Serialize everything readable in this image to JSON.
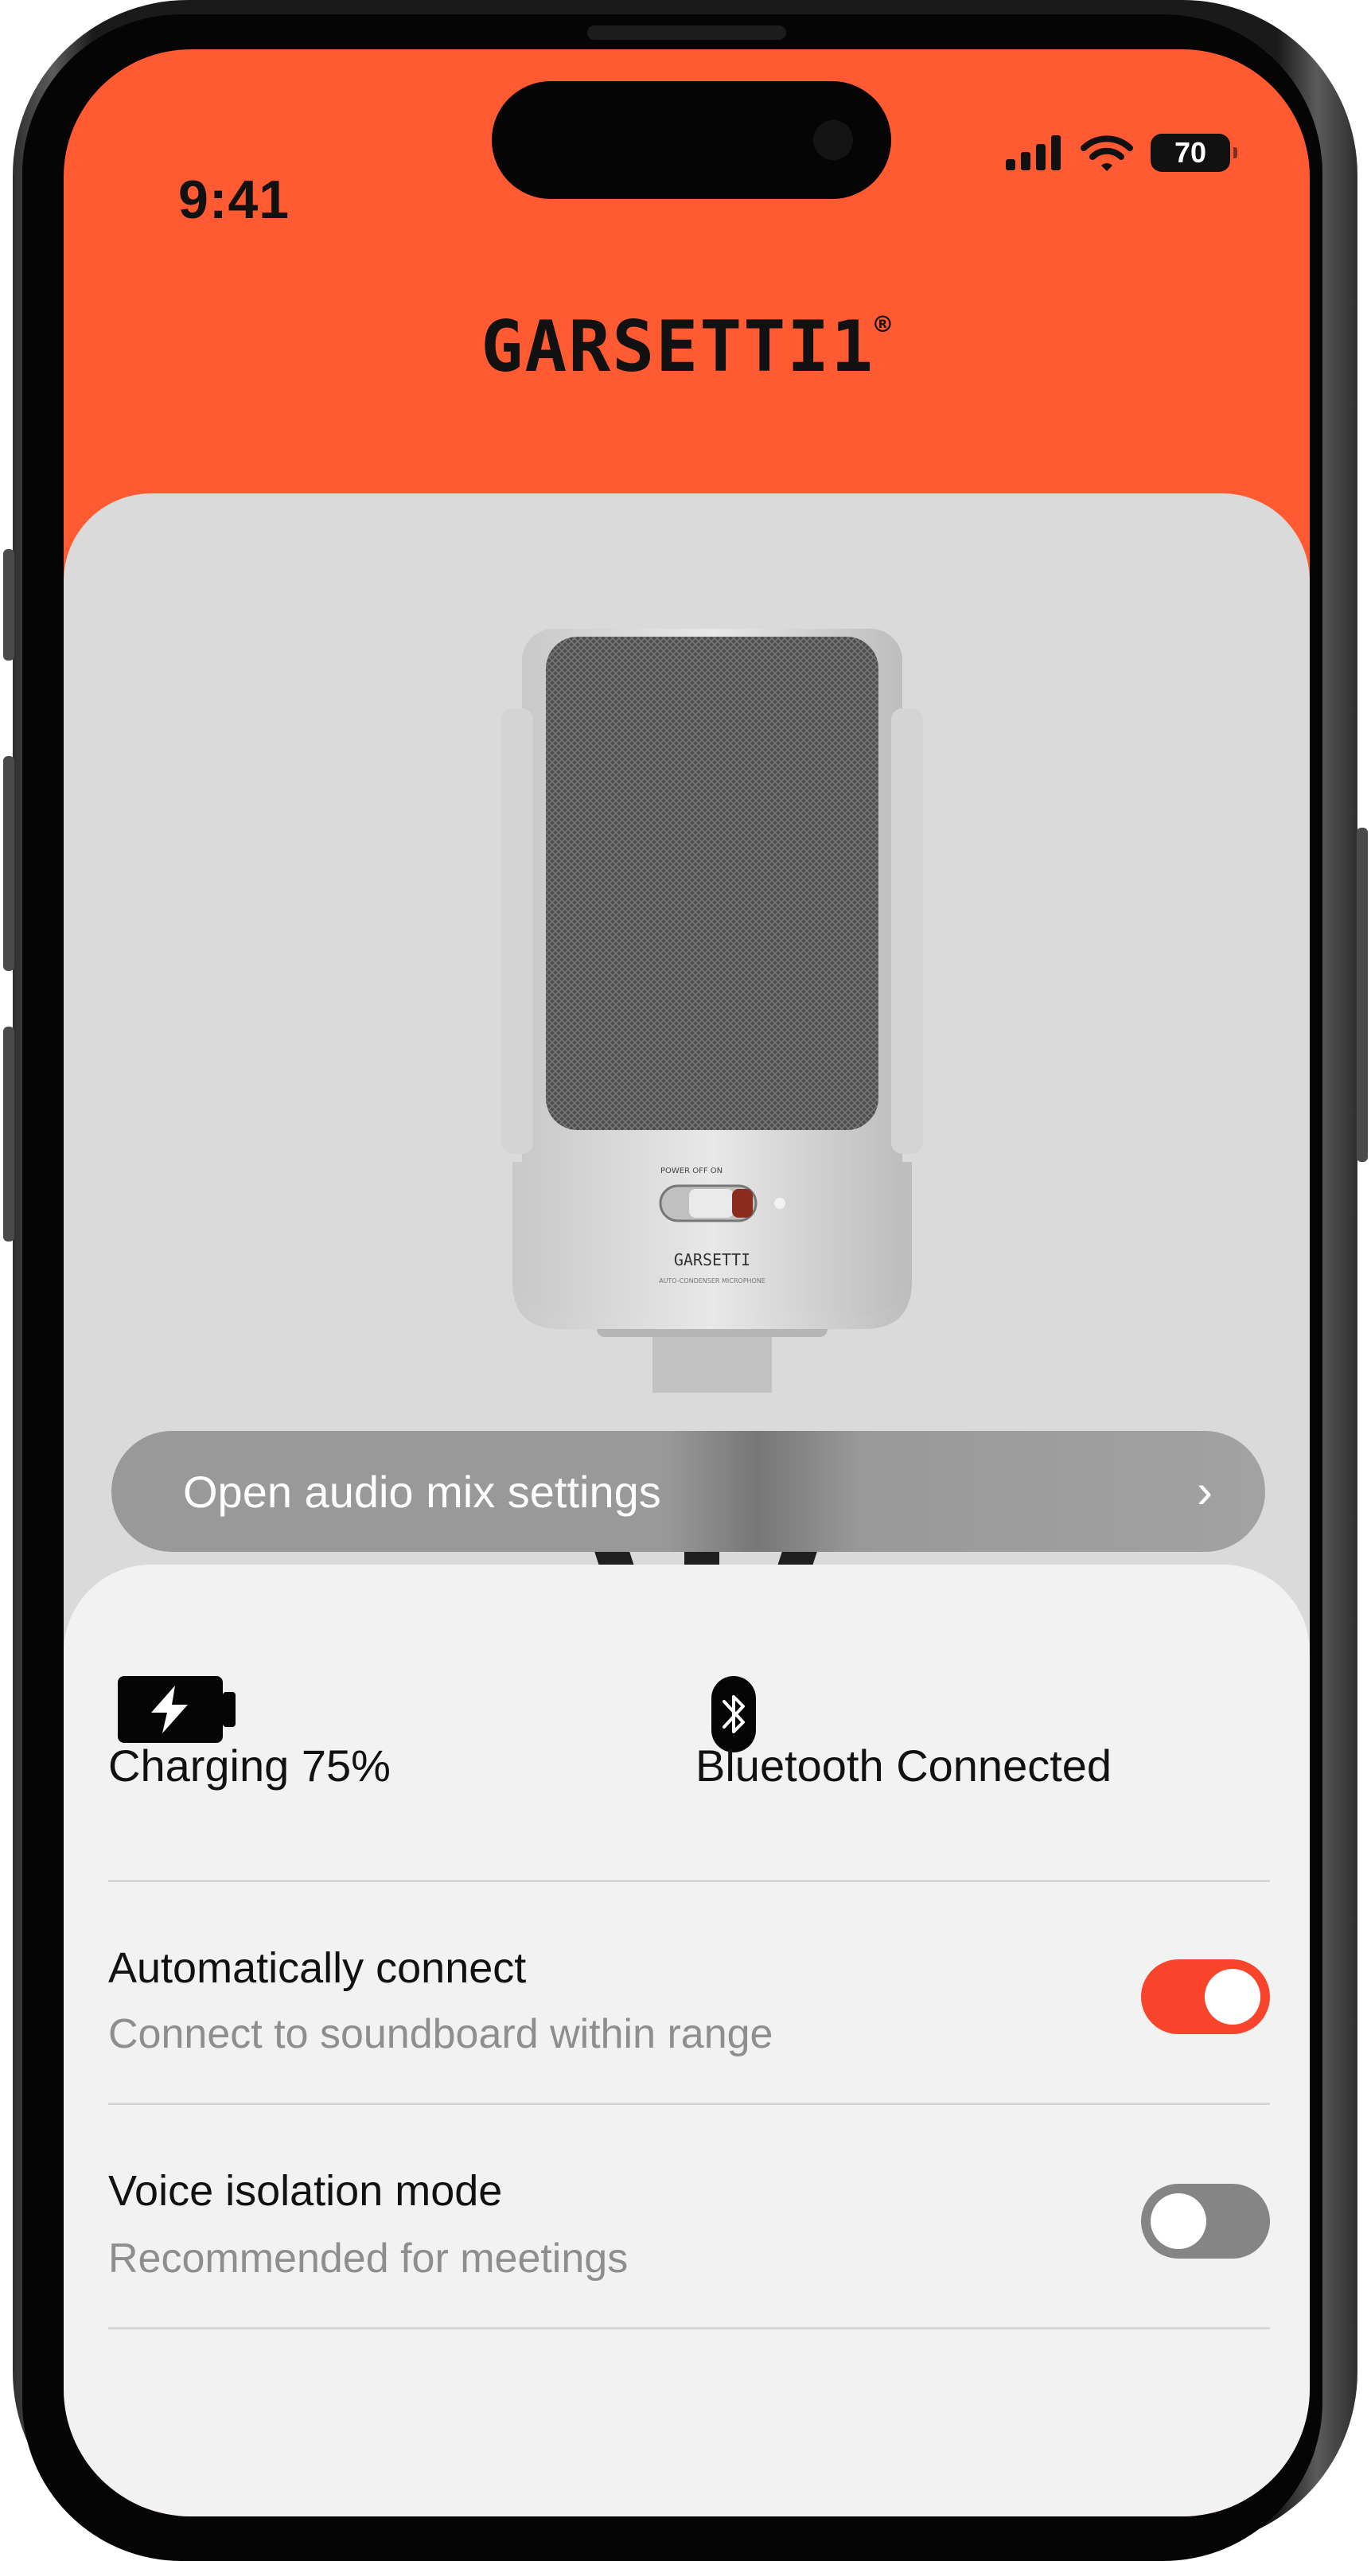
{
  "status_bar": {
    "time": "9:41",
    "battery": "70"
  },
  "brand": {
    "name": "GARSETTI1",
    "mark": "®"
  },
  "product": {
    "open_audio_label": "Open audio mix settings"
  },
  "stats": {
    "charging": {
      "label": "Charging 75%",
      "icon": "battery-charging-icon"
    },
    "bluetooth": {
      "label": "Bluetooth Connected",
      "icon": "bluetooth-icon"
    }
  },
  "settings": [
    {
      "title": "Automatically connect",
      "subtitle": "Connect to soundboard within range",
      "enabled": true
    },
    {
      "title": "Voice isolation mode",
      "subtitle": "Recommended for meetings",
      "enabled": false
    }
  ],
  "colors": {
    "accent": "#ff5a31",
    "toggle_on": "#f8442a",
    "toggle_off": "#858585",
    "sheet": "#f3f2f3",
    "card": "#dadada"
  }
}
